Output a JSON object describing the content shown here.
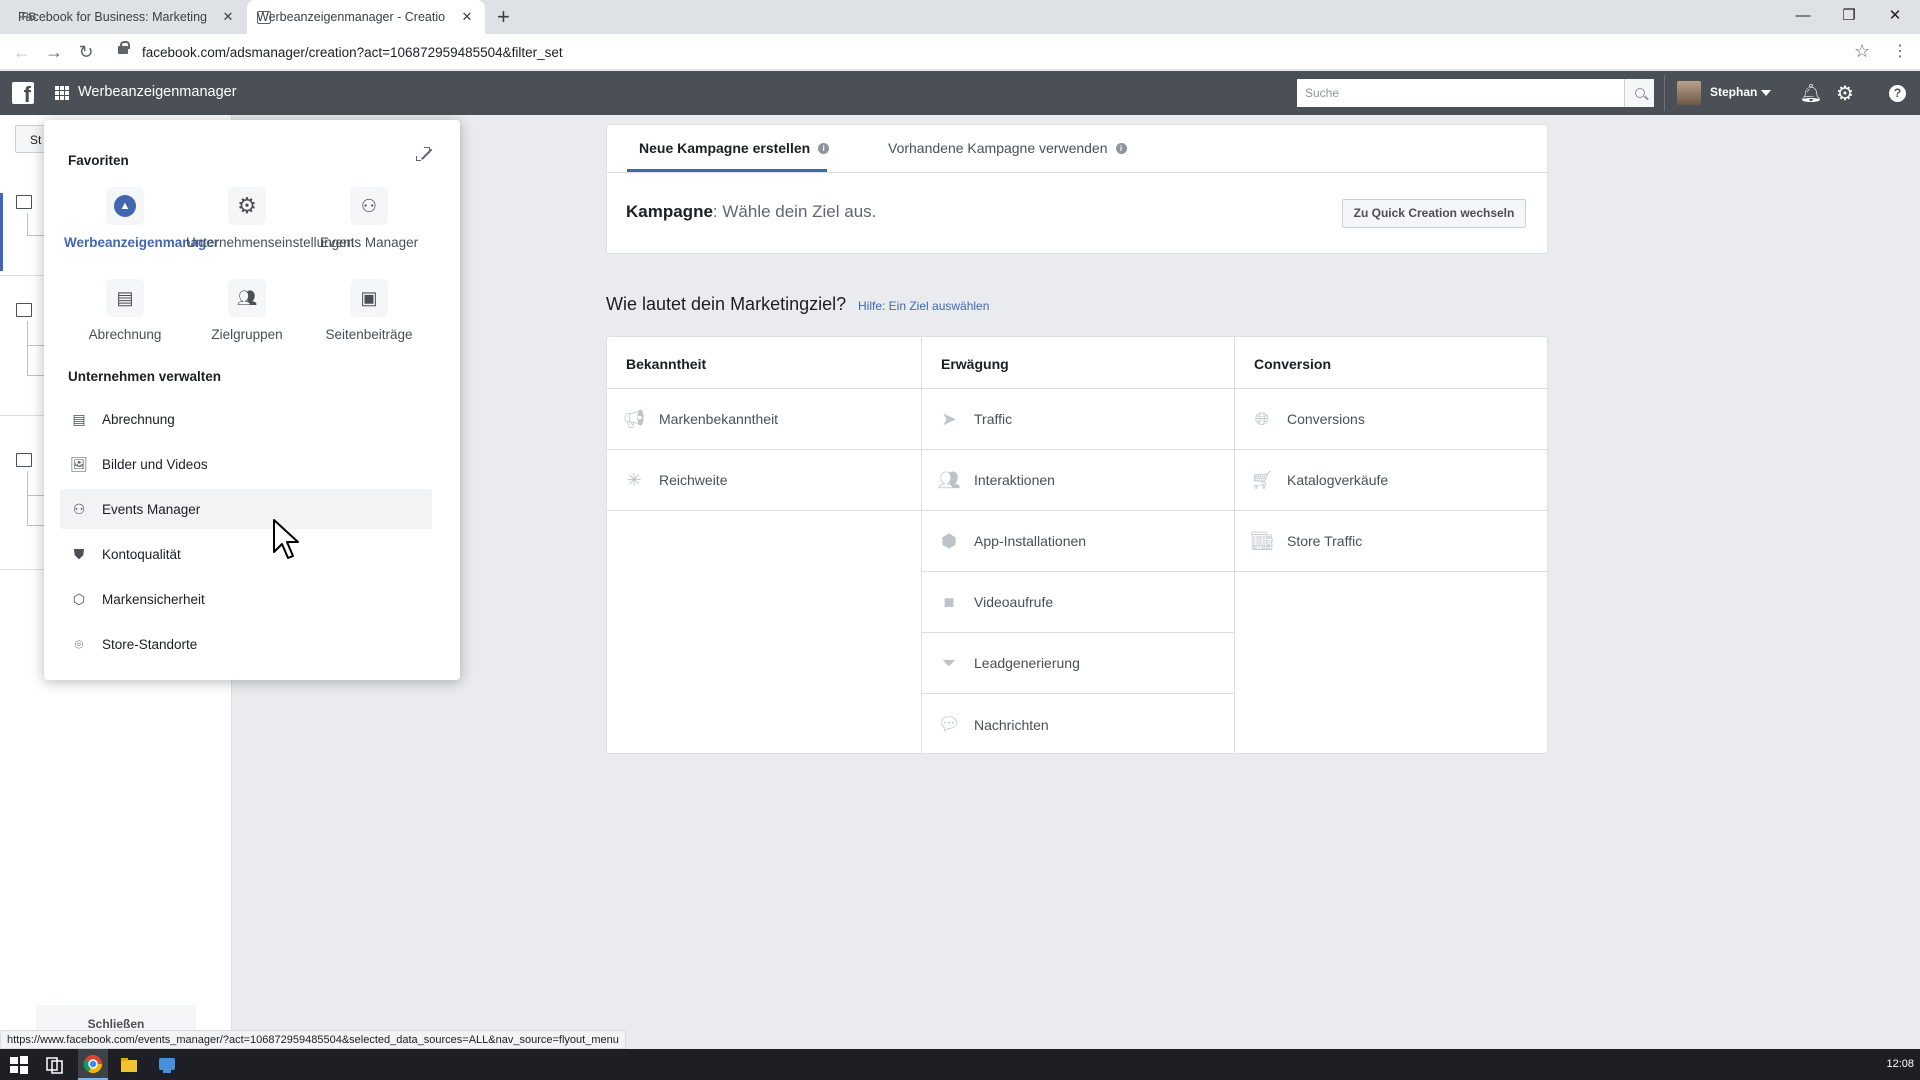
{
  "browser": {
    "tabs": [
      {
        "favicon": "FB",
        "title": "Facebook for Business: Marketing"
      },
      {
        "favicon": "",
        "title": "Werbeanzeigenmanager - Creatio"
      }
    ],
    "url": "facebook.com/adsmanager/creation?act=106872959485504&filter_set",
    "status_url": "https://www.facebook.com/events_manager/?act=106872959485504&selected_data_sources=ALL&nav_source=flyout_menu"
  },
  "topnav": {
    "app_title": "Werbeanzeigenmanager",
    "search_placeholder": "Suche",
    "user_name": "Stephan"
  },
  "sidebar": {
    "button_label": "St",
    "close_label": "Schließen"
  },
  "flyout": {
    "favorites_title": "Favoriten",
    "favorites": [
      {
        "label": "Werbeanzeigenmanager",
        "icon": "ads-manager-icon"
      },
      {
        "label": "Unternehmenseinstellungen",
        "icon": "gear-icon"
      },
      {
        "label": "Events Manager",
        "icon": "events-manager-icon"
      },
      {
        "label": "Abrechnung",
        "icon": "billing-icon"
      },
      {
        "label": "Zielgruppen",
        "icon": "audiences-icon"
      },
      {
        "label": "Seitenbeiträge",
        "icon": "page-posts-icon"
      }
    ],
    "manage_title": "Unternehmen verwalten",
    "manage_items": [
      {
        "label": "Abrechnung",
        "icon": "billing-icon"
      },
      {
        "label": "Bilder und Videos",
        "icon": "images-icon"
      },
      {
        "label": "Events Manager",
        "icon": "events-manager-icon"
      },
      {
        "label": "Kontoqualität",
        "icon": "shield-icon"
      },
      {
        "label": "Markensicherheit",
        "icon": "brand-safety-icon"
      },
      {
        "label": "Store-Standorte",
        "icon": "store-location-icon"
      }
    ]
  },
  "campaign": {
    "tab_new": "Neue Kampagne erstellen",
    "tab_existing": "Vorhandene Kampagne verwenden",
    "label_bold": "Kampagne",
    "label_rest": ": Wähle dein Ziel aus.",
    "quick_creation_button": "Zu Quick Creation wechseln"
  },
  "objectives": {
    "question": "Wie lautet dein Marketingziel?",
    "help_link": "Hilfe: Ein Ziel auswählen",
    "columns": [
      {
        "header": "Bekanntheit",
        "items": [
          {
            "label": "Markenbekanntheit",
            "icon": "megaphone-icon"
          },
          {
            "label": "Reichweite",
            "icon": "reach-icon"
          }
        ]
      },
      {
        "header": "Erwägung",
        "items": [
          {
            "label": "Traffic",
            "icon": "cursor-icon"
          },
          {
            "label": "Interaktionen",
            "icon": "people-icon"
          },
          {
            "label": "App-Installationen",
            "icon": "box-icon"
          },
          {
            "label": "Videoaufrufe",
            "icon": "video-icon"
          },
          {
            "label": "Leadgenerierung",
            "icon": "funnel-icon"
          },
          {
            "label": "Nachrichten",
            "icon": "chat-icon"
          }
        ]
      },
      {
        "header": "Conversion",
        "items": [
          {
            "label": "Conversions",
            "icon": "globe-icon"
          },
          {
            "label": "Katalogverkäufe",
            "icon": "cart-icon"
          },
          {
            "label": "Store Traffic",
            "icon": "store-icon"
          }
        ]
      }
    ]
  },
  "taskbar": {
    "clock": "12:08"
  },
  "colors": {
    "brand": "#4267b2",
    "nav_bg": "#4b4f56"
  }
}
